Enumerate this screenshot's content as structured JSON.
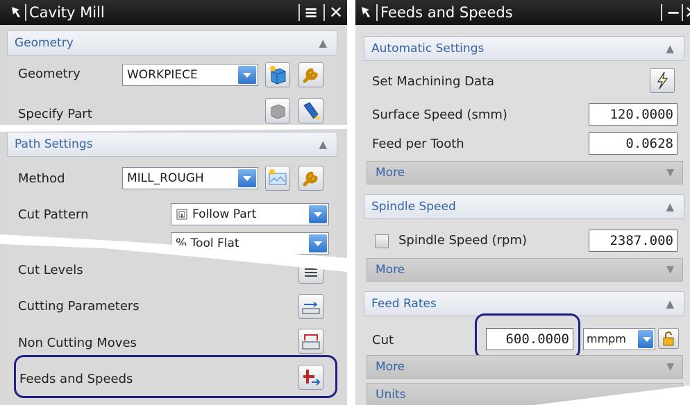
{
  "left_panel": {
    "title": "Cavity Mill",
    "window_buttons": {
      "menu": "≡",
      "close": "✕"
    },
    "geometry": {
      "header": "Geometry",
      "geometry_label": "Geometry",
      "geometry_value": "WORKPIECE",
      "specify_part_label": "Specify Part"
    },
    "path_settings": {
      "header": "Path Settings",
      "method_label": "Method",
      "method_value": "MILL_ROUGH",
      "cut_pattern_label": "Cut Pattern",
      "cut_pattern_value": "Follow Part",
      "stepover_value": "% Tool Flat",
      "cut_levels_label": "Cut Levels",
      "cutting_parameters_label": "Cutting Parameters",
      "non_cutting_moves_label": "Non Cutting Moves",
      "feeds_and_speeds_label": "Feeds and Speeds"
    }
  },
  "right_panel": {
    "title": "Feeds and Speeds",
    "window_buttons": {
      "minimize": "−",
      "close": "✕"
    },
    "automatic_settings": {
      "header": "Automatic Settings",
      "set_machining_data_label": "Set Machining Data",
      "surface_speed_label": "Surface Speed (smm)",
      "surface_speed_value": "120.0000",
      "feed_per_tooth_label": "Feed per Tooth",
      "feed_per_tooth_value": "0.0628",
      "more_label": "More"
    },
    "spindle_speed": {
      "header": "Spindle Speed",
      "spindle_speed_label": "Spindle Speed (rpm)",
      "spindle_speed_value": "2387.000",
      "more_label": "More"
    },
    "feed_rates": {
      "header": "Feed Rates",
      "cut_label": "Cut",
      "cut_value": "600.0000",
      "cut_unit": "mmpm",
      "more_label": "More",
      "units_label": "Units"
    }
  },
  "colors": {
    "accent": "#3565a6",
    "highlight": "#1d2383",
    "dropdown_arrow": "#2f73cd"
  }
}
